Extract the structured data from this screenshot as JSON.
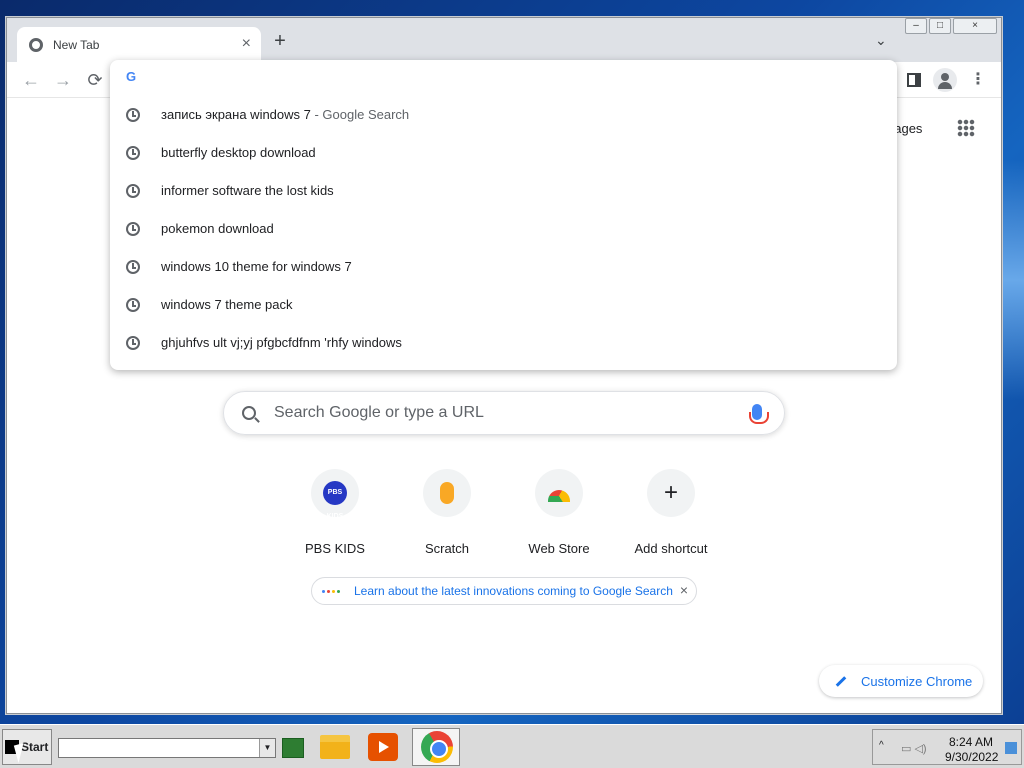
{
  "browser": {
    "tab": {
      "title": "New Tab",
      "close": "×"
    },
    "new_tab_label": "+",
    "tab_search_label": "⌄",
    "window_controls": {
      "minimize": "–",
      "maximize": "□",
      "close": "×"
    },
    "nav": {
      "back": "←",
      "forward": "→",
      "reload": "⟳"
    },
    "menu_label": "⋮"
  },
  "omnibox": {
    "value": "",
    "provider_logo": "G",
    "suggestions": [
      {
        "text": "запись экрана windows 7",
        "suffix": " - Google Search"
      },
      {
        "text": "butterfly desktop download",
        "suffix": ""
      },
      {
        "text": "informer software the lost kids",
        "suffix": ""
      },
      {
        "text": "pokemon download",
        "suffix": ""
      },
      {
        "text": "windows 10 theme for windows 7",
        "suffix": ""
      },
      {
        "text": "windows 7 theme pack",
        "suffix": ""
      },
      {
        "text": "ghjuhfvs ult vj;yj pfgbcfdfnm 'rhfy windows",
        "suffix": ""
      }
    ]
  },
  "ntp": {
    "images_link": "nages",
    "search_placeholder": "Search Google or type a URL",
    "shortcuts": [
      {
        "label": "PBS KIDS",
        "icon": "pbs-kids-icon",
        "badge": "PBS KIDS"
      },
      {
        "label": "Scratch",
        "icon": "scratch-icon"
      },
      {
        "label": "Web Store",
        "icon": "web-store-icon"
      },
      {
        "label": "Add shortcut",
        "icon": "plus-icon",
        "glyph": "+"
      }
    ],
    "promo_text": "Learn about the latest innovations coming to Google Search",
    "promo_close": "×",
    "customize_label": "Customize Chrome"
  },
  "taskbar": {
    "start_label": "Start",
    "combo_arrow": "▼",
    "tray_up": "^",
    "time": "8:24 AM",
    "date": "9/30/2022"
  },
  "colors": {
    "accent": "#1a73e8",
    "desktop": "#0d47a1",
    "toolbar": "#dee1e6"
  }
}
